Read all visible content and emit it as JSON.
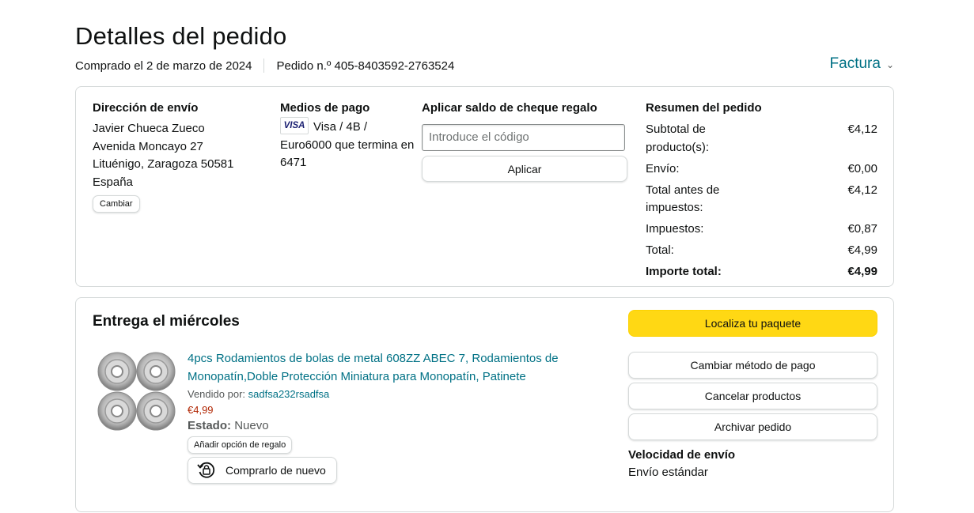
{
  "header": {
    "title": "Detalles del pedido",
    "purchased": "Comprado el 2 de marzo de 2024",
    "order_number": "Pedido n.º 405-8403592-2763524",
    "invoice_label": "Factura"
  },
  "shipping": {
    "title": "Dirección de envío",
    "name": "Javier Chueca Zueco",
    "street": "Avenida Moncayo 27",
    "city": "Lituénigo, Zaragoza 50581",
    "country": "España",
    "change_label": "Cambiar"
  },
  "payment": {
    "title": "Medios de pago",
    "card_brand": "VISA",
    "method_text": "Visa / 4B / Euro6000 que termina en 6471"
  },
  "gift_card": {
    "title": "Aplicar saldo de cheque regalo",
    "input_placeholder": "Introduce el código",
    "apply_label": "Aplicar"
  },
  "summary": {
    "title": "Resumen del pedido",
    "rows": [
      {
        "label": "Subtotal de producto(s):",
        "value": "€4,12"
      },
      {
        "label": "Envío:",
        "value": "€0,00"
      },
      {
        "label": "Total antes de impuestos:",
        "value": "€4,12"
      },
      {
        "label": "Impuestos:",
        "value": "€0,87"
      },
      {
        "label": "Total:",
        "value": "€4,99"
      },
      {
        "label": "Importe total:",
        "value": "€4,99"
      }
    ]
  },
  "delivery": {
    "title": "Entrega el miércoles",
    "product": {
      "title": "4pcs Rodamientos de bolas de metal 608ZZ ABEC 7, Rodamientos de Monopatín,Doble Protección Miniatura para Monopatín, Patinete",
      "sold_by_label": "Vendido por:",
      "seller": "sadfsa232rsadfsa",
      "price": "€4,99",
      "status_label": "Estado:",
      "status_value": "Nuevo",
      "gift_option_label": "Añadir opción de regalo",
      "buy_again_label": "Comprarlo de nuevo"
    },
    "actions": {
      "track": "Localiza tu paquete",
      "change_payment": "Cambiar método de pago",
      "cancel": "Cancelar productos",
      "archive": "Archivar pedido"
    },
    "speed_title": "Velocidad de envío",
    "speed_value": "Envío estándar"
  },
  "colors": {
    "link": "#007185",
    "price": "#b12704",
    "primary_button": "#ffd814",
    "border": "#d5d9d9"
  }
}
